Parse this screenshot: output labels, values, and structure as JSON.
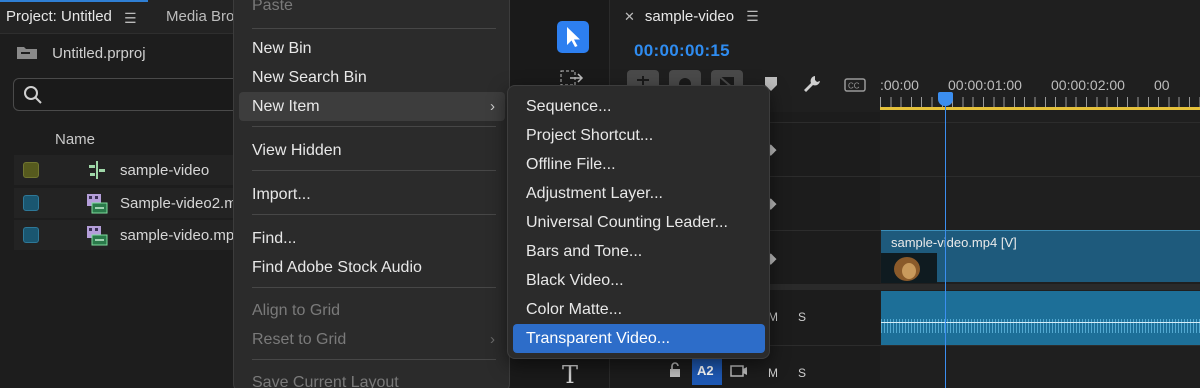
{
  "project_panel": {
    "active_tab": "Project: Untitled",
    "inactive_tab": "Media Bro",
    "project_file": "Untitled.prproj",
    "column_name": "Name",
    "items": [
      {
        "label": "sample-video",
        "chip_color": "#565a1e",
        "icon": "sequence-icon"
      },
      {
        "label": "Sample-video2.m",
        "chip_color": "#1a5670",
        "icon": "video-clip-icon"
      },
      {
        "label": "sample-video.mp",
        "chip_color": "#1a5670",
        "icon": "video-clip-icon"
      }
    ]
  },
  "context_menu": {
    "partial_top": "Paste",
    "new_bin": "New Bin",
    "new_search_bin": "New Search Bin",
    "new_item": "New Item",
    "view_hidden": "View Hidden",
    "import": "Import...",
    "find": "Find...",
    "find_stock_audio": "Find Adobe Stock Audio",
    "align_to_grid": "Align to Grid",
    "reset_to_grid": "Reset to Grid",
    "save_layout": "Save Current Layout",
    "submenu_arrow": "›"
  },
  "submenu": {
    "items": [
      "Sequence...",
      "Project Shortcut...",
      "Offline File...",
      "Adjustment Layer...",
      "Universal Counting Leader...",
      "Bars and Tone...",
      "Black Video...",
      "Color Matte...",
      "Transparent Video..."
    ],
    "selected": "Transparent Video..."
  },
  "timeline": {
    "tab_title": "sample-video",
    "timecode": "00:00:00:15",
    "ruler_labels": [
      ":00:00",
      "00:00:01:00",
      "00:00:02:00",
      "00"
    ],
    "video_clip_label": "sample-video.mp4 [V]",
    "track_m": "M",
    "track_s": "S",
    "audio_track": "A2",
    "accent": "#2f8cf0",
    "work_area_color": "#e5c13a"
  }
}
